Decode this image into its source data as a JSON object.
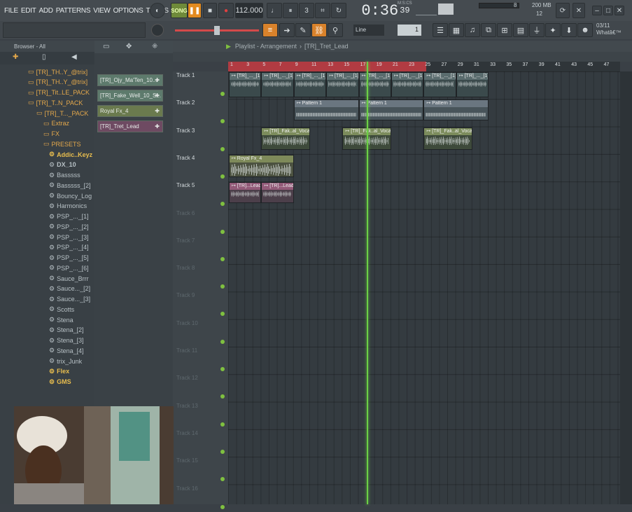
{
  "menu": [
    "FILE",
    "EDIT",
    "ADD",
    "PATTERNS",
    "VIEW",
    "OPTIONS",
    "TOOLS",
    "HELP"
  ],
  "transport": {
    "song_label": "SONG",
    "tempo": "112.000",
    "time": "0:36",
    "time_sub": "39",
    "time_unit": "M:S:CS"
  },
  "meters": {
    "cpu": "8",
    "ram": "200 MB",
    "voices": "12"
  },
  "hint": {
    "date": "03/11",
    "text": "Whatâ€™"
  },
  "snap": {
    "value": "Line"
  },
  "browser": {
    "title": "Browser - All",
    "items": [
      {
        "label": "[TR]_TH..Y_@trix]",
        "kind": "folder"
      },
      {
        "label": "[TR]_TH..Y_@trix]",
        "kind": "folder"
      },
      {
        "label": "[TR]_Tit..LE_PACK",
        "kind": "folder"
      },
      {
        "label": "[TR]_T..N_PACK",
        "kind": "folder"
      },
      {
        "label": "[TR]_T..._PACK",
        "kind": "folder"
      },
      {
        "label": "Extraz",
        "kind": "folder"
      },
      {
        "label": "FX",
        "kind": "folder"
      },
      {
        "label": "PRESETS",
        "kind": "folder"
      },
      {
        "label": "Addic..Keyz",
        "kind": "hi"
      },
      {
        "label": "DX_10",
        "kind": "preset-bold"
      },
      {
        "label": "Basssss",
        "kind": "preset"
      },
      {
        "label": "Basssss_[2]",
        "kind": "preset"
      },
      {
        "label": "Bouncy_Log",
        "kind": "preset"
      },
      {
        "label": "Harmonics",
        "kind": "preset"
      },
      {
        "label": "PSP_..._[1]",
        "kind": "preset"
      },
      {
        "label": "PSP_..._[2]",
        "kind": "preset"
      },
      {
        "label": "PSP_..._[3]",
        "kind": "preset"
      },
      {
        "label": "PSP_..._[4]",
        "kind": "preset"
      },
      {
        "label": "PSP_..._[5]",
        "kind": "preset"
      },
      {
        "label": "PSP_..._[6]",
        "kind": "preset"
      },
      {
        "label": "Sauce_Brrr",
        "kind": "preset"
      },
      {
        "label": "Sauce..._[2]",
        "kind": "preset"
      },
      {
        "label": "Sauce..._[3]",
        "kind": "preset"
      },
      {
        "label": "Scotts",
        "kind": "preset"
      },
      {
        "label": "Stena",
        "kind": "preset"
      },
      {
        "label": "Stena_[2]",
        "kind": "preset"
      },
      {
        "label": "Stena_[3]",
        "kind": "preset"
      },
      {
        "label": "Stena_[4]",
        "kind": "preset"
      },
      {
        "label": "trix_Junk",
        "kind": "preset"
      },
      {
        "label": "Flex",
        "kind": "hi"
      },
      {
        "label": "GMS",
        "kind": "hi"
      }
    ]
  },
  "channels": [
    {
      "label": "[TR]_Ojy_Ma'Ten_10...",
      "color": "#5d7a6c"
    },
    {
      "label": "[TR]_Fake_Well_10_S...",
      "color": "#5d7a6c"
    },
    {
      "label": "Royal Fx_4",
      "color": "#6a7a4e"
    },
    {
      "label": "[TR]_Tret_Lead",
      "color": "#6e4a62"
    }
  ],
  "playlist": {
    "title": "Playlist - Arrangement",
    "sep": "›",
    "pattern": "[TR]_Tret_Lead",
    "ruler": [
      "1",
      "3",
      "5",
      "7",
      "9",
      "11",
      "13",
      "15",
      "17",
      "19",
      "21",
      "23",
      "25",
      "27",
      "29",
      "31",
      "33",
      "35",
      "37",
      "39",
      "41",
      "43",
      "45",
      "47"
    ],
    "tracks": [
      "Track 1",
      "Track 2",
      "Track 3",
      "Track 4",
      "Track 5",
      "Track 6",
      "Track 7",
      "Track 8",
      "Track 9",
      "Track 10",
      "Track 11",
      "Track 12",
      "Track 13",
      "Track 14",
      "Track 15",
      "Track 16"
    ],
    "clips": [
      {
        "track": 0,
        "start": 1,
        "len": 4,
        "label": "[TR]_..._[1]",
        "type": "audio"
      },
      {
        "track": 0,
        "start": 5,
        "len": 4,
        "label": "[TR]_..._[1]",
        "type": "audio"
      },
      {
        "track": 0,
        "start": 9,
        "len": 4,
        "label": "[TR]_..._[1]",
        "type": "audio"
      },
      {
        "track": 0,
        "start": 13,
        "len": 4,
        "label": "[TR]_..._[1]",
        "type": "audio"
      },
      {
        "track": 0,
        "start": 17,
        "len": 4,
        "label": "[TR]_..._[1]",
        "type": "audio"
      },
      {
        "track": 0,
        "start": 21,
        "len": 4,
        "label": "[TR]_..._[1]",
        "type": "audio"
      },
      {
        "track": 0,
        "start": 25,
        "len": 4,
        "label": "[TR]_..._[1]",
        "type": "audio"
      },
      {
        "track": 0,
        "start": 29,
        "len": 4,
        "label": "[TR]_..._[1]",
        "type": "audio"
      },
      {
        "track": 1,
        "start": 9,
        "len": 8,
        "label": "Pattern 1",
        "type": "pattern"
      },
      {
        "track": 1,
        "start": 17,
        "len": 8,
        "label": "Pattern 1",
        "type": "pattern"
      },
      {
        "track": 1,
        "start": 25,
        "len": 8,
        "label": "Pattern 1",
        "type": "pattern"
      },
      {
        "track": 2,
        "start": 5,
        "len": 6,
        "label": "[TR]_Fak..al_Vocal",
        "type": "vocal"
      },
      {
        "track": 2,
        "start": 15,
        "len": 6,
        "label": "[TR]_Fak..al_Vocal",
        "type": "vocal"
      },
      {
        "track": 2,
        "start": 25,
        "len": 6,
        "label": "[TR]_Fak..al_Vocal",
        "type": "vocal"
      },
      {
        "track": 3,
        "start": 1,
        "len": 8,
        "label": "Royal Fx_4",
        "type": "fx"
      },
      {
        "track": 4,
        "start": 1,
        "len": 4,
        "label": "[TR]...Lead",
        "type": "lead"
      },
      {
        "track": 4,
        "start": 5,
        "len": 4,
        "label": "[TR]...Lead",
        "type": "lead"
      }
    ]
  }
}
